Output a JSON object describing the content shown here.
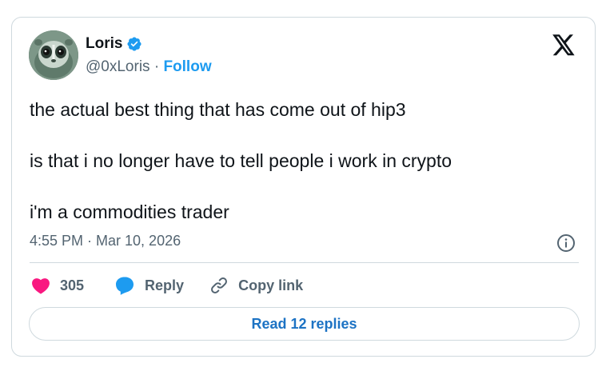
{
  "author": {
    "display_name": "Loris",
    "handle": "@0xLoris",
    "separator": "·",
    "follow_label": "Follow",
    "verified": true,
    "verified_color": "#1d9bf0"
  },
  "tweet": {
    "lines": [
      "the actual best thing that has come out of hip3",
      "is that i no longer have to tell people i work in crypto",
      "i'm a commodities trader"
    ],
    "timestamp": "4:55 PM · Mar 10, 2026"
  },
  "actions": {
    "like_count": "305",
    "reply_label": "Reply",
    "copy_link_label": "Copy link",
    "read_replies_label": "Read 12 replies"
  },
  "icons": {
    "platform": "x-logo-icon",
    "verified": "verified-badge-icon",
    "info": "info-icon",
    "like": "heart-icon",
    "reply": "reply-bubble-icon",
    "copy": "link-icon"
  },
  "colors": {
    "accent": "#1d9bf0",
    "like": "#f91880",
    "text_primary": "#0f1419",
    "text_secondary": "#536471",
    "border": "#cfd9de"
  }
}
